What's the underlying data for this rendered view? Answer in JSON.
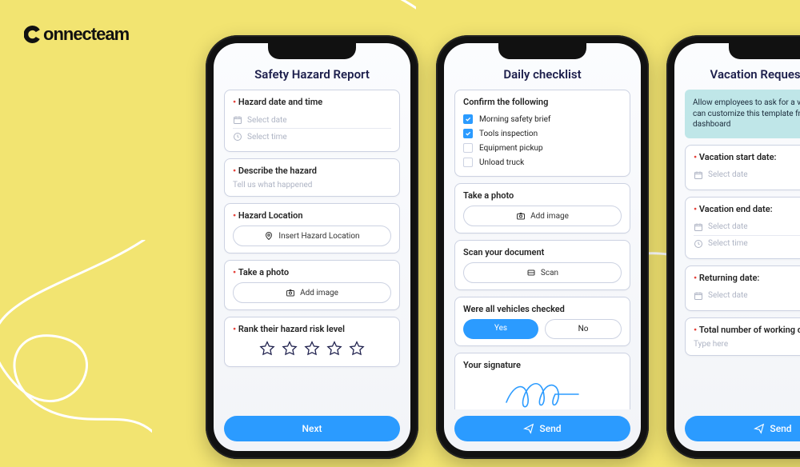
{
  "brand": "connecteam",
  "phone1": {
    "title": "Safety Hazard Report",
    "hazard_dt_label": "Hazard date and time",
    "select_date": "Select date",
    "select_time": "Select time",
    "describe_label": "Describe the hazard",
    "describe_ph": "Tell us what happened",
    "location_label": "Hazard Location",
    "location_ph": "Insert Hazard Location",
    "photo_label": "Take a photo",
    "add_image": "Add image",
    "rank_label": "Rank their hazard risk level",
    "next": "Next"
  },
  "phone2": {
    "title": "Daily checklist",
    "confirm_label": "Confirm the following",
    "items": [
      {
        "label": "Morning safety brief",
        "checked": true
      },
      {
        "label": "Tools inspection",
        "checked": true
      },
      {
        "label": "Equipment pickup",
        "checked": false
      },
      {
        "label": "Unload truck",
        "checked": false
      }
    ],
    "photo_label": "Take a photo",
    "add_image": "Add image",
    "scan_label": "Scan your document",
    "scan": "Scan",
    "vehicles_label": "Were all vehicles checked",
    "yes": "Yes",
    "no": "No",
    "sig_label": "Your signature",
    "send": "Send"
  },
  "phone3": {
    "title": "Vacation Request Form",
    "info": "Allow employees to ask for a vacation. You can customize this template from the dashboard",
    "start_label": "Vacation start date:",
    "select_date": "Select date",
    "end_label": "Vacation end date:",
    "select_time": "Select time",
    "return_label": "Returning date:",
    "days_label": "Total number of working days missed:",
    "type_here": "Type here",
    "send": "Send"
  }
}
